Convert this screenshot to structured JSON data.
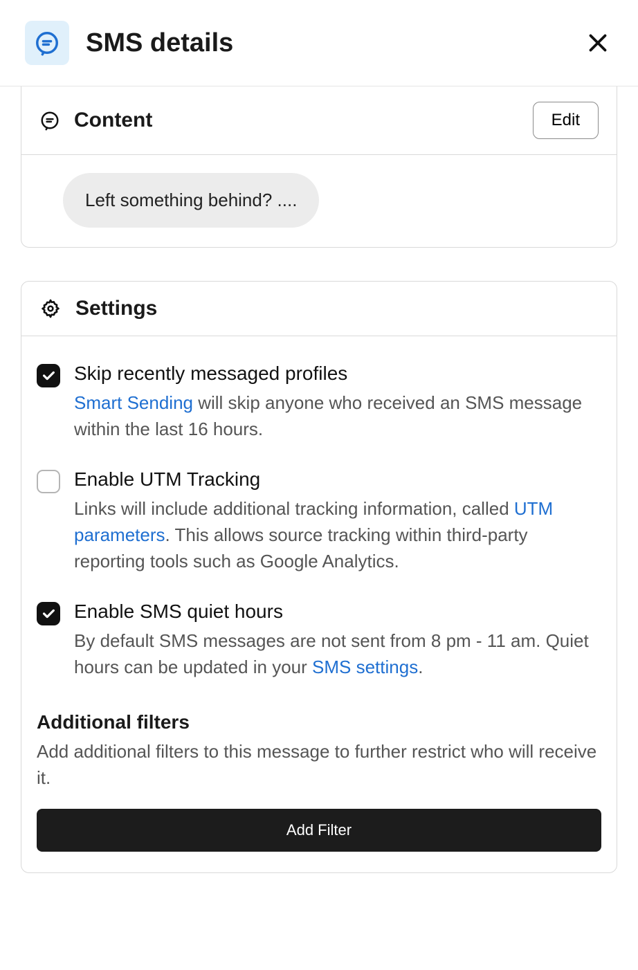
{
  "header": {
    "title": "SMS details"
  },
  "content": {
    "title": "Content",
    "edit_label": "Edit",
    "message_preview": "Left something behind? ...."
  },
  "settings": {
    "title": "Settings",
    "items": [
      {
        "checked": true,
        "label": "Skip recently messaged profiles",
        "desc_before": "",
        "link": "Smart Sending",
        "desc_after": " will skip anyone who received an SMS message within the last 16 hours."
      },
      {
        "checked": false,
        "label": "Enable UTM Tracking",
        "desc_before": "Links will include additional tracking information, called ",
        "link": "UTM parameters",
        "desc_after": ". This allows source tracking within third-party reporting tools such as Google Analytics."
      },
      {
        "checked": true,
        "label": "Enable SMS quiet hours",
        "desc_before": "By default SMS messages are not sent from 8 pm - 11 am. Quiet hours can be updated in your ",
        "link": "SMS settings",
        "desc_after": "."
      }
    ],
    "filters_header": "Additional filters",
    "filters_desc": "Add additional filters to this message to further restrict who will receive it.",
    "add_filter_label": "Add Filter"
  }
}
